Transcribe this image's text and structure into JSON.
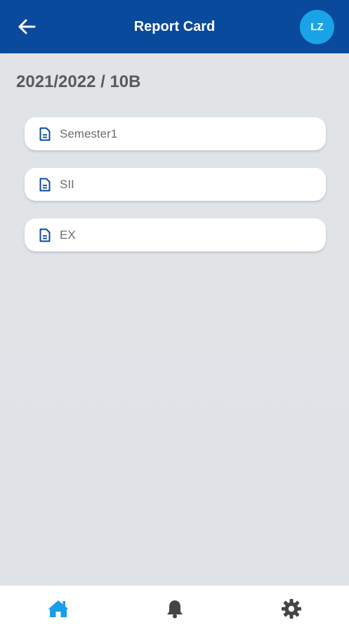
{
  "header": {
    "title": "Report Card",
    "avatar_initials": "LZ",
    "back_icon": "arrow-left-icon",
    "bar_color": "#0a4a9c",
    "avatar_color": "#1aa3e8"
  },
  "main": {
    "term_heading": "2021/2022 / 10B",
    "reports": [
      {
        "label": "Semester1",
        "icon": "document-icon"
      },
      {
        "label": "SII",
        "icon": "document-icon"
      },
      {
        "label": "EX",
        "icon": "document-icon"
      }
    ]
  },
  "bottom_nav": {
    "items": [
      {
        "icon": "home-icon",
        "active": true,
        "color": "#1a9de8"
      },
      {
        "icon": "bell-icon",
        "active": false,
        "color": "#444444"
      },
      {
        "icon": "gear-icon",
        "active": false,
        "color": "#444444"
      }
    ]
  }
}
